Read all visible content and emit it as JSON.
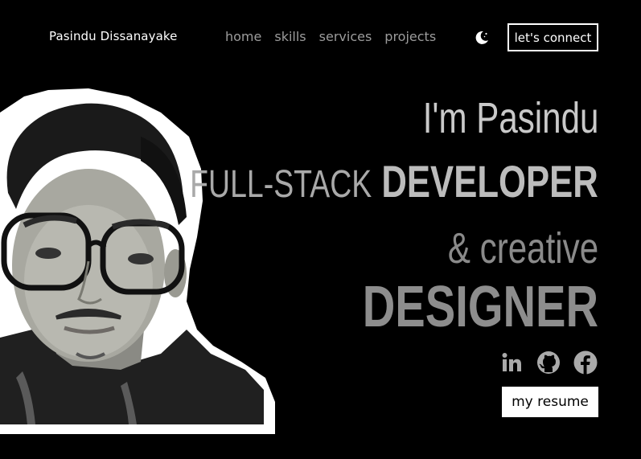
{
  "header": {
    "brand": "Pasindu Dissanayake",
    "nav": [
      "home",
      "skills",
      "services",
      "projects"
    ],
    "theme_icon": "moon-icon",
    "cta": "let's connect"
  },
  "hero": {
    "greeting": "I'm Pasindu",
    "role_prefix": "FULL-STACK",
    "role_main": "DEVELOPER",
    "amp": "&",
    "role2_prefix": "creative",
    "role2_main": "DESIGNER",
    "photo": "portrait-photo"
  },
  "socials": [
    "linkedin-icon",
    "github-icon",
    "facebook-icon"
  ],
  "resume_button": "my resume",
  "colors": {
    "background": "#000000",
    "text": "#ffffff",
    "nav": "#9c9c9c"
  }
}
